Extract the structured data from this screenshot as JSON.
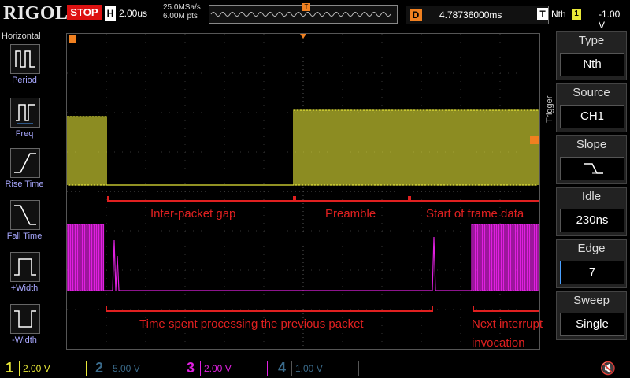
{
  "topbar": {
    "brand": "RIGOL",
    "run_state": "STOP",
    "timebase_label": "H",
    "timebase_value": "2.00us",
    "sample_rate": "25.0MSa/s",
    "memory_depth": "6.00M pts",
    "delay_label": "D",
    "delay_value": "4.78736000ms",
    "trigger_label": "T",
    "trigger_type": "Nth",
    "trigger_channel": "1",
    "trigger_level": "-1.00 V"
  },
  "left_panel": {
    "title": "Horizontal",
    "items": [
      {
        "label": "Period",
        "icon": "period-icon"
      },
      {
        "label": "Freq",
        "icon": "freq-icon"
      },
      {
        "label": "Rise Time",
        "icon": "rise-time-icon"
      },
      {
        "label": "Fall Time",
        "icon": "fall-time-icon"
      },
      {
        "label": "+Width",
        "icon": "pos-width-icon"
      },
      {
        "label": "-Width",
        "icon": "neg-width-icon"
      }
    ]
  },
  "screen": {
    "annotations": {
      "inter_packet_gap": "Inter-packet gap",
      "preamble": "Preamble",
      "start_of_frame": "Start of frame data",
      "processing": "Time spent processing the previous packet",
      "next_interrupt": "Next interrupt",
      "invocation": "invocation"
    },
    "marker_t": "T",
    "ch1_marker": "1",
    "ch3_marker": "3"
  },
  "right_panel": {
    "side_label": "Trigger",
    "blocks": [
      {
        "title": "Type",
        "value": "Nth"
      },
      {
        "title": "Source",
        "value": "CH1"
      },
      {
        "title": "Slope",
        "value": ""
      },
      {
        "title": "Idle",
        "value": "230ns"
      },
      {
        "title": "Edge",
        "value": "7"
      },
      {
        "title": "Sweep",
        "value": "Single"
      }
    ]
  },
  "bottom_bar": {
    "channels": [
      {
        "num": "1",
        "scale": "2.00 V",
        "color": "#e8e838"
      },
      {
        "num": "2",
        "scale": "5.00 V",
        "color": "#3a6a8a"
      },
      {
        "num": "3",
        "scale": "2.00 V",
        "color": "#e020e0"
      },
      {
        "num": "4",
        "scale": "1.00 V",
        "color": "#3a6a8a"
      }
    ]
  },
  "colors": {
    "ch1": "#e8e838",
    "ch3": "#e020e0",
    "annotation": "#e02020",
    "trigger": "#f08020"
  }
}
